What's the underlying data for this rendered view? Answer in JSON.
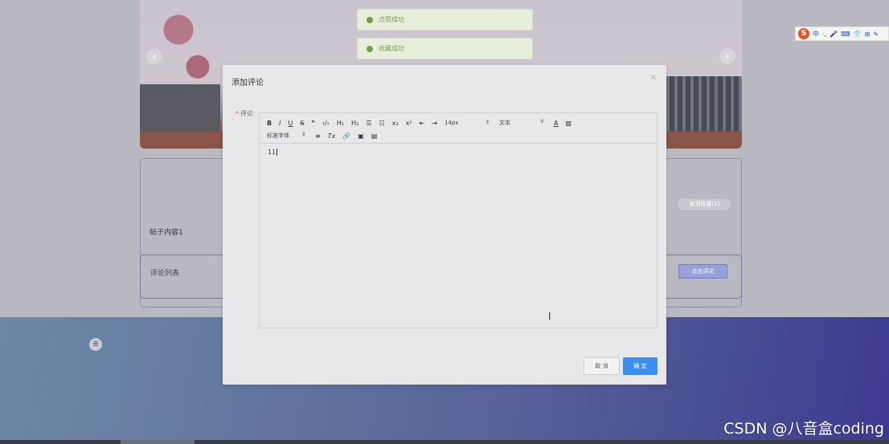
{
  "toasts": [
    {
      "text": "点赞成功"
    },
    {
      "text": "收藏成功"
    }
  ],
  "carousel": {
    "prev_icon": "chevron-left-icon",
    "next_icon": "chevron-right-icon"
  },
  "post": {
    "content": "帖子内容1",
    "collect_button": "取消收藏(1)",
    "comment_list_label": "评论列表",
    "click_comment_button": "点击评论"
  },
  "modal": {
    "title": "添加评论",
    "close_label": "×",
    "field_label": "评论",
    "required_mark": "*",
    "toolbar": {
      "row1": [
        "B",
        "I",
        "U",
        "S",
        "❞",
        "‹/›",
        "H₁",
        "H₂",
        "☰",
        "☷",
        "x₂",
        "x²",
        "⇤",
        "⇥"
      ],
      "font_size": "14px",
      "text_type": "文本",
      "color_buttons": [
        "A",
        "▨"
      ],
      "font_family": "标准字体",
      "row2": [
        "≡",
        "Tx",
        "🔗",
        "▣",
        "▤"
      ]
    },
    "content": "11",
    "cancel_label": "取 消",
    "ok_label": "确 定"
  },
  "ime": {
    "logo": "S",
    "items": [
      "中",
      "·,",
      "🎤",
      "⌨",
      "👕",
      "⊞",
      "✎"
    ]
  },
  "watermark": "CSDN @八音盒coding",
  "colors": {
    "primary": "#3d8ef1",
    "success": "#6ea043",
    "required": "#e05a5a"
  }
}
